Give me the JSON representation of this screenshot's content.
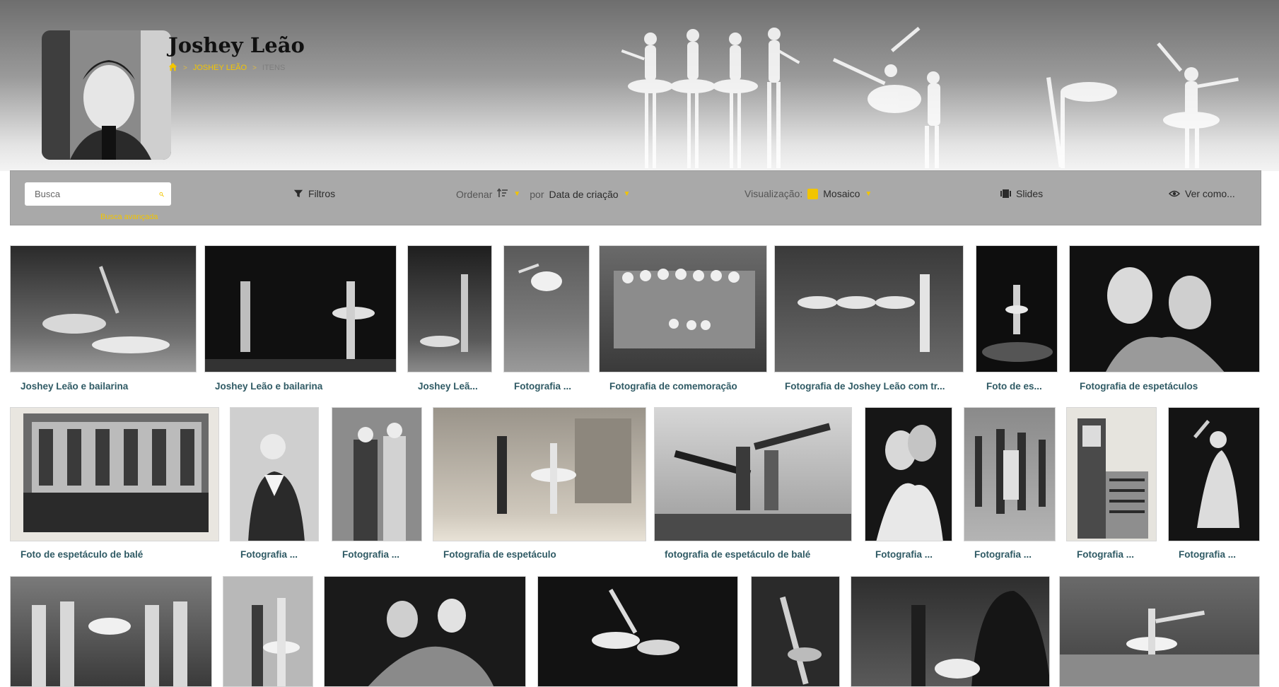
{
  "header": {
    "title": "Joshey Leão",
    "breadcrumb": [
      {
        "label": "Joshey Leão",
        "current": false
      },
      {
        "label": "Itens",
        "current": true
      }
    ]
  },
  "toolbar": {
    "search_placeholder": "Busca",
    "advanced_search": "Busca avançada",
    "filters": "Filtros",
    "sort_label": "Ordenar",
    "sort_by_label": "por",
    "sort_field": "Data de criação",
    "view_label": "Visualização:",
    "view_mode": "Mosaico",
    "slides": "Slides",
    "view_as": "Ver como..."
  },
  "colors": {
    "accent": "#f2c500",
    "link": "#2f5a64",
    "toolbar": "#a9a9a9"
  },
  "items": [
    {
      "title": "Joshey Leão e bailarina"
    },
    {
      "title": "Joshey Leão e bailarina"
    },
    {
      "title": "Joshey Leã..."
    },
    {
      "title": "Fotografia ..."
    },
    {
      "title": "Fotografia de comemoração"
    },
    {
      "title": "Fotografia de Joshey Leão com tr..."
    },
    {
      "title": "Foto de es..."
    },
    {
      "title": "Fotografia de espetáculos"
    },
    {
      "title": "Foto de espetáculo de balé"
    },
    {
      "title": "Fotografia ..."
    },
    {
      "title": "Fotografia ..."
    },
    {
      "title": "Fotografia de espetáculo"
    },
    {
      "title": "fotografia de espetáculo de balé"
    },
    {
      "title": "Fotografia ..."
    },
    {
      "title": "Fotografia ..."
    },
    {
      "title": "Fotografia ..."
    },
    {
      "title": "Fotografia ..."
    }
  ]
}
